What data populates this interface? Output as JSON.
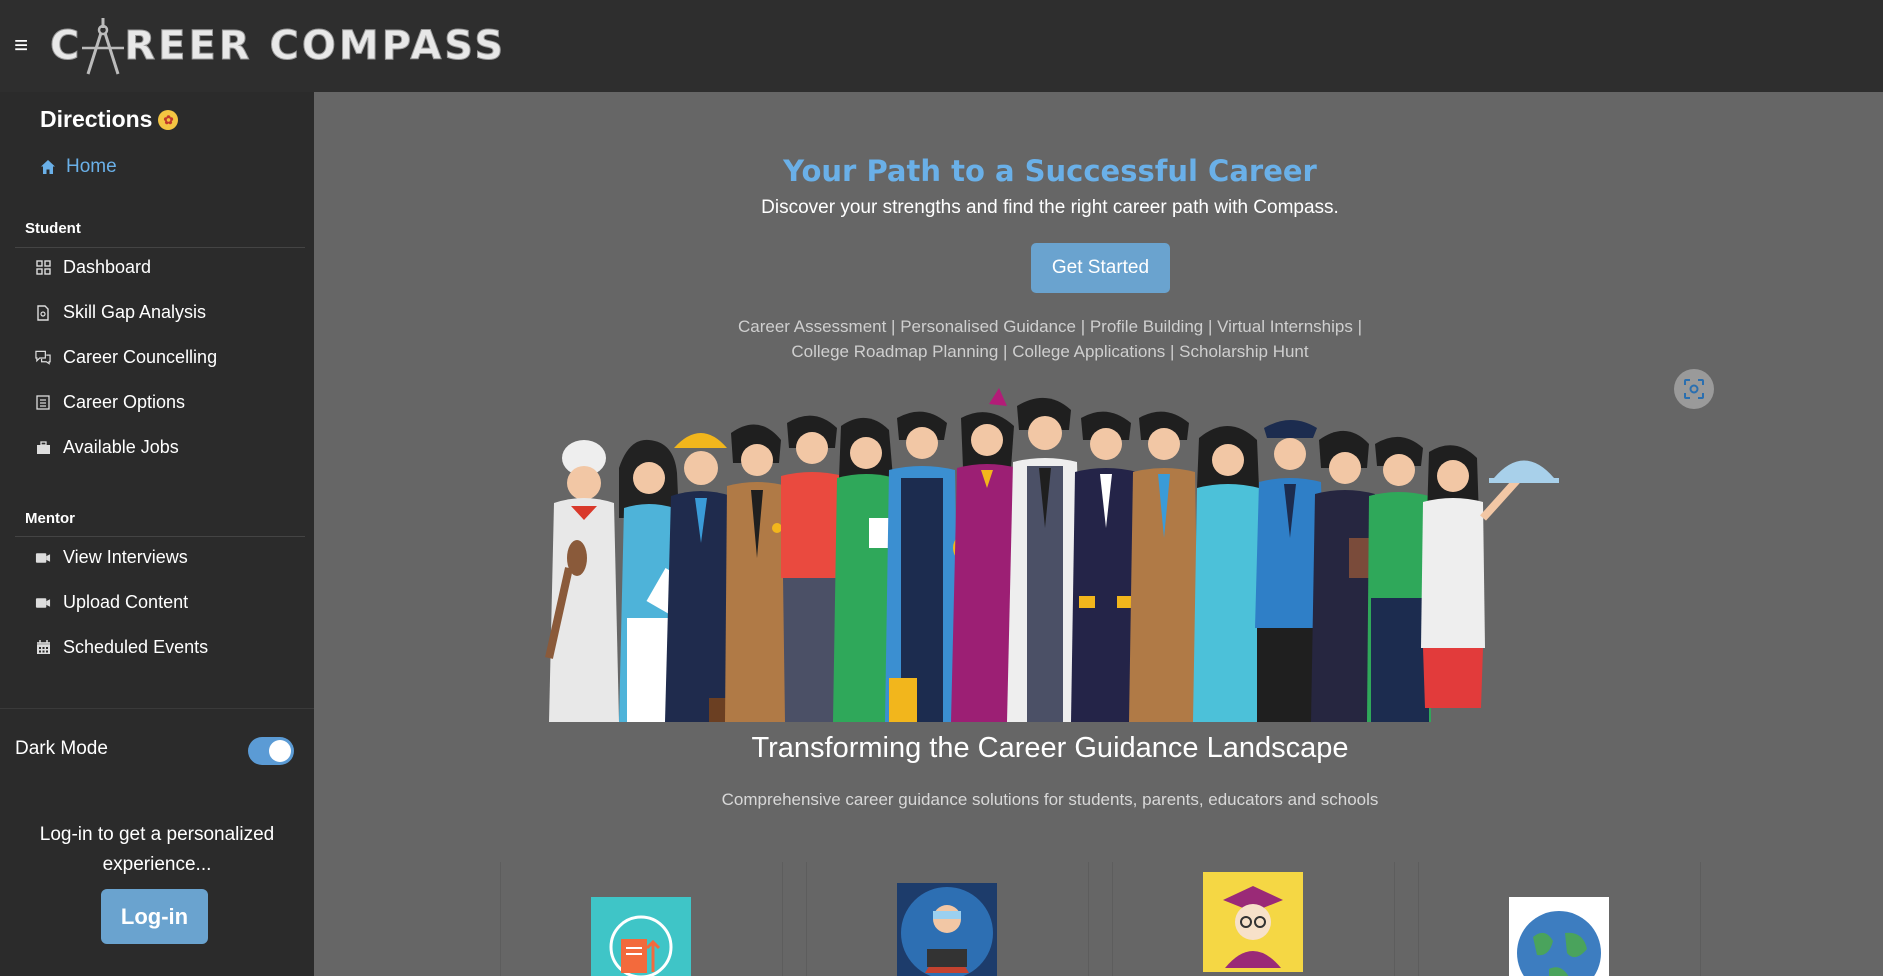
{
  "app": {
    "title": "CAREER COMPASS",
    "title_left": "C",
    "title_right": "REER COMPASS"
  },
  "sidebar": {
    "heading": "Directions",
    "home_label": "Home",
    "sections": [
      {
        "label": "Student",
        "items": [
          {
            "label": "Dashboard",
            "icon": "grid-icon"
          },
          {
            "label": "Skill Gap Analysis",
            "icon": "document-icon"
          },
          {
            "label": "Career Councelling",
            "icon": "chat-icon"
          },
          {
            "label": "Career Options",
            "icon": "list-icon"
          },
          {
            "label": "Available Jobs",
            "icon": "briefcase-icon"
          }
        ]
      },
      {
        "label": "Mentor",
        "items": [
          {
            "label": "View Interviews",
            "icon": "video-icon"
          },
          {
            "label": "Upload Content",
            "icon": "video-icon"
          },
          {
            "label": "Scheduled Events",
            "icon": "calendar-icon"
          }
        ]
      }
    ],
    "dark_mode_label": "Dark Mode",
    "dark_mode_on": true,
    "login_prompt": "Log-in to get a personalized experience...",
    "login_button": "Log-in"
  },
  "hero": {
    "title": "Your Path to a Successful Career",
    "subtitle": "Discover your strengths and find the right career path with Compass.",
    "cta": "Get Started",
    "services_line1": "Career Assessment | Personalised Guidance | Profile Building | Virtual Internships |",
    "services_line2": "College Roadmap Planning | College Applications | Scholarship Hunt"
  },
  "section": {
    "title": "Transforming the Career Guidance Landscape",
    "subtitle": "Comprehensive career guidance solutions for students, parents, educators and schools"
  },
  "colors": {
    "accent": "#6ab0e8",
    "button": "#6aa3cf",
    "topbar": "#2e2e2e",
    "sidebar": "#2b2b2b",
    "main_bg": "#666666"
  }
}
